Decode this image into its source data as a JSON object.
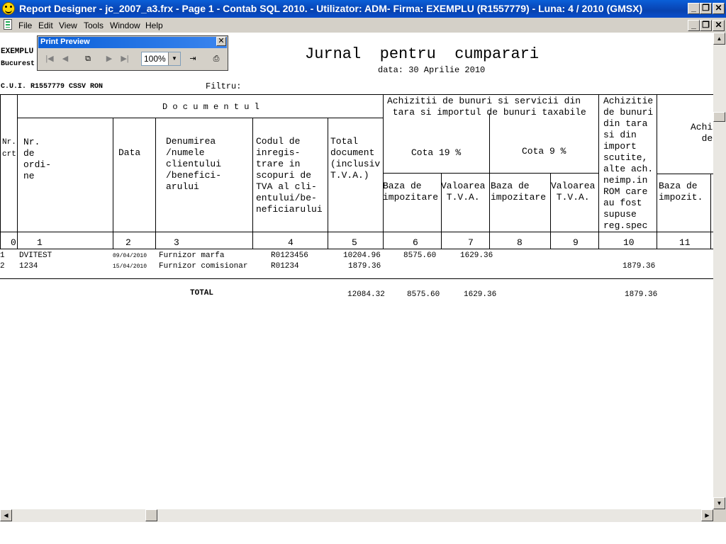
{
  "window": {
    "title": "Report Designer - jc_2007_a3.frx - Page 1 - Contab SQL 2010. - Utilizator: ADM- Firma: EXEMPLU (R1557779) - Luna: 4 / 2010       (GMSX)",
    "buttons": {
      "minimize": "_",
      "restore": "❐",
      "close": "✕"
    }
  },
  "menu": [
    "File",
    "Edit",
    "View",
    "Tools",
    "Window",
    "Help"
  ],
  "print_preview": {
    "title": "Print Preview",
    "zoom": "100%",
    "buttons": [
      "first-page",
      "previous-page",
      "multiple-pages",
      "next-page",
      "last-page",
      "close-preview",
      "print"
    ]
  },
  "report": {
    "company": "EXEMPLU",
    "city": "Bucurest",
    "title": "Jurnal  pentru  cumparari",
    "date": "data: 30 Aprilie 2010",
    "cui": "C.U.I. R1557779 CSSV  RON",
    "filter_label": "Filtru:",
    "headers": {
      "nr_crt": "Nr.\ncrt",
      "documentul": "D o c u m e n t u l",
      "nr_ordine": "Nr.\nde\nordi-\nne",
      "data": "Data",
      "denumire": "Denumirea\n/numele\nclientului\n/benefici-\narului",
      "cod": "Codul de\ninregis-\ntrare in\nscopuri de\nTVA al cli-\nentului/be-\nneficiarului",
      "total": "Total\ndocument\n(inclusiv\nT.V.A.)",
      "achizitii": "Achizitii de bunuri si servicii din\n tara si importul de bunuri taxabile",
      "cota19": "Cota 19 %",
      "cota9": "Cota 9 %",
      "baza1": "Baza de\nimpozitare",
      "val1": "Valoarea\n T.V.A.",
      "baza2": "Baza de\nimpozitare",
      "val2": "Valoarea\n T.V.A.",
      "achizitie_scutite": "Achizitie\nde bunuri\ndin tara\nsi din\nimport\nscutite,\nalte ach.\nneimp.in\nROM care\nau fost\nsupuse\nreg.spec",
      "achi_partial": "Achi\n  de",
      "baza_impozit": "Baza de\nimpozit.",
      "col_numbers": [
        "0",
        "1",
        "2",
        "3",
        "4",
        "5",
        "6",
        "7",
        "8",
        "9",
        "10",
        "11"
      ]
    },
    "rows": [
      {
        "nr": "1",
        "nr_ordine": "DVITEST",
        "data": "09/04/2010",
        "denumire": "Furnizor marfa",
        "cod": "R0123456",
        "total": "10204.96",
        "baza19": "8575.60",
        "tva19": "1629.36",
        "scutite": ""
      },
      {
        "nr": "2",
        "nr_ordine": "1234",
        "data": "15/04/2010",
        "denumire": "Furnizor comisionar",
        "cod": "R01234",
        "total": "1879.36",
        "baza19": "",
        "tva19": "",
        "scutite": "1879.36"
      }
    ],
    "totals": {
      "label": "TOTAL",
      "total": "12084.32",
      "baza19": "8575.60",
      "tva19": "1629.36",
      "scutite": "1879.36"
    }
  }
}
